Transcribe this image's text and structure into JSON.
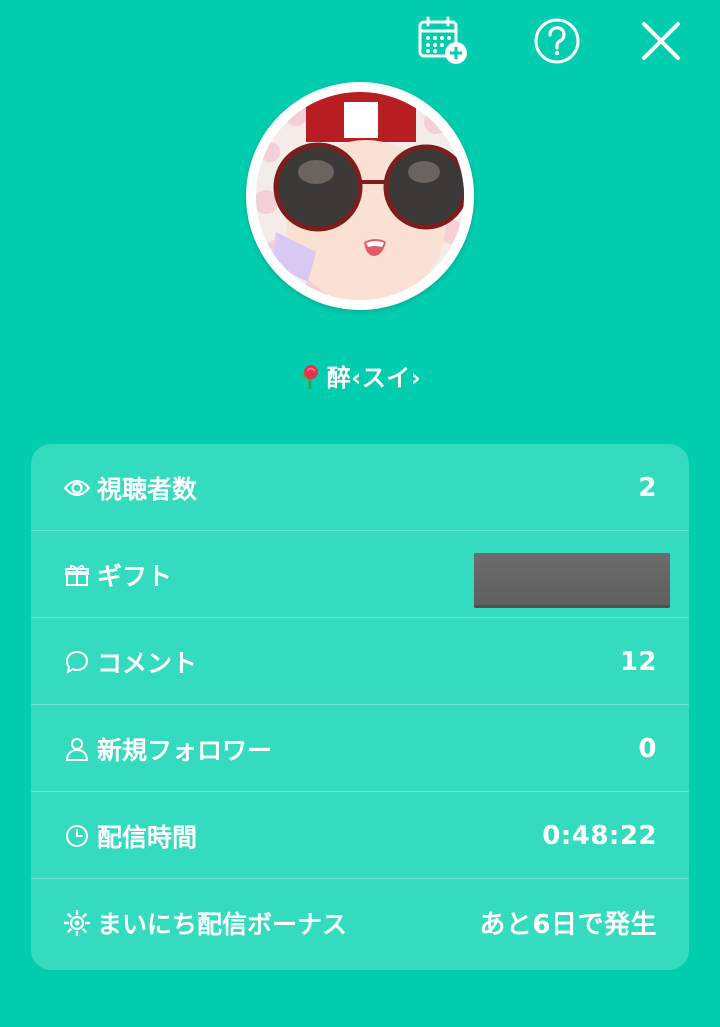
{
  "header": {
    "icons": [
      "calendar-add-icon",
      "help-icon",
      "close-icon"
    ]
  },
  "profile": {
    "username": "醉‹スイ›"
  },
  "stats": {
    "viewers": {
      "label": "視聴者数",
      "value": "2",
      "icon": "eye-icon"
    },
    "gifts": {
      "label": "ギフト",
      "value": "",
      "icon": "gift-icon"
    },
    "comments": {
      "label": "コメント",
      "value": "12",
      "icon": "speech-bubble-icon"
    },
    "followers": {
      "label": "新規フォロワー",
      "value": "0",
      "icon": "person-icon"
    },
    "duration": {
      "label": "配信時間",
      "value": "0:48:22",
      "icon": "clock-icon"
    },
    "bonus": {
      "label": "まいにち配信ボーナス",
      "value": "あと6日で発生",
      "icon": "bonus-sun-icon"
    }
  },
  "colors": {
    "background": "#02CDAE",
    "card": "#35DBBE",
    "text": "#FFFFFF"
  }
}
